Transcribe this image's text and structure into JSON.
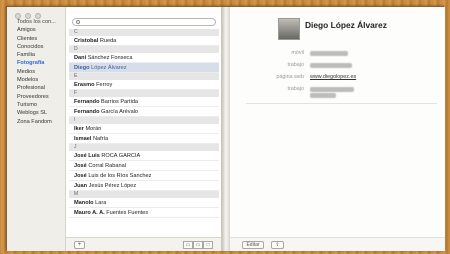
{
  "groups": [
    {
      "label": "Todos los con...",
      "type": "header"
    },
    {
      "label": "Amigos"
    },
    {
      "label": "Clientes"
    },
    {
      "label": "Conocidos"
    },
    {
      "label": "Familia"
    },
    {
      "label": "Fotografía",
      "active": true
    },
    {
      "label": "Medios"
    },
    {
      "label": "Modelos"
    },
    {
      "label": "Profesional"
    },
    {
      "label": "Proveedores"
    },
    {
      "label": "Turismo"
    },
    {
      "label": "Weblogs SL"
    },
    {
      "label": "Zona Fandom"
    }
  ],
  "contacts": [
    {
      "section": "C"
    },
    {
      "first": "Cristobal",
      "last": "Rueda"
    },
    {
      "section": "D"
    },
    {
      "first": "Dani",
      "last": "Sánchez Fonseca"
    },
    {
      "first": "Diego",
      "last": "López Álvarez",
      "selected": true
    },
    {
      "section": "E"
    },
    {
      "first": "Erasmo",
      "last": "Ferroy"
    },
    {
      "section": "F"
    },
    {
      "first": "Fernando",
      "last": "Barrios Partida"
    },
    {
      "first": "Fernando",
      "last": "García Arévalo"
    },
    {
      "section": "I"
    },
    {
      "first": "Iker",
      "last": "Morán"
    },
    {
      "first": "Ismael",
      "last": "Nafría"
    },
    {
      "section": "J"
    },
    {
      "first": "José Luis",
      "last": "ROCA GARCIA"
    },
    {
      "first": "José",
      "last": "Corral Rabanal"
    },
    {
      "first": "José",
      "last": "Luis de los Ríos Sanchez"
    },
    {
      "first": "Juan",
      "last": "Jesús Pérez López"
    },
    {
      "section": "M"
    },
    {
      "first": "Manolo",
      "last": "Lara"
    },
    {
      "first": "Mauro A. A.",
      "last": "Fuentes Fuentes"
    }
  ],
  "names_footer": {
    "add_label": "+",
    "view_icons": [
      "card-view-icon",
      "list-view-icon",
      "single-view-icon"
    ]
  },
  "detail": {
    "name": "Diego López Álvarez",
    "fields": [
      {
        "label": "móvil",
        "blurred": true
      },
      {
        "label": "trabajo",
        "blurred": true
      },
      {
        "label": "página web",
        "value": "www.diegolopez.es",
        "link": true
      },
      {
        "label": "trabajo",
        "blurred": true,
        "multiline": true
      }
    ],
    "edit_label": "Editar",
    "share_icon": "share-icon"
  }
}
